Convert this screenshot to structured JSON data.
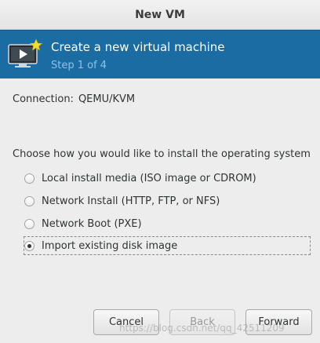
{
  "window": {
    "title": "New VM"
  },
  "banner": {
    "title": "Create a new virtual machine",
    "step": "Step 1 of 4",
    "icon": "monitor-with-star-icon"
  },
  "connection": {
    "label": "Connection:",
    "value": "QEMU/KVM"
  },
  "install": {
    "prompt": "Choose how you would like to install the operating system",
    "options": [
      {
        "label": "Local install media (ISO image or CDROM)",
        "selected": false
      },
      {
        "label": "Network Install (HTTP, FTP, or NFS)",
        "selected": false
      },
      {
        "label": "Network Boot (PXE)",
        "selected": false
      },
      {
        "label": "Import existing disk image",
        "selected": true
      }
    ]
  },
  "buttons": {
    "cancel": "Cancel",
    "back": "Back",
    "forward": "Forward"
  },
  "watermark": "https://blog.csdn.net/qq_42511209",
  "colors": {
    "banner": "#1b6ca3",
    "banner_subtitle": "#8fc1e6"
  }
}
